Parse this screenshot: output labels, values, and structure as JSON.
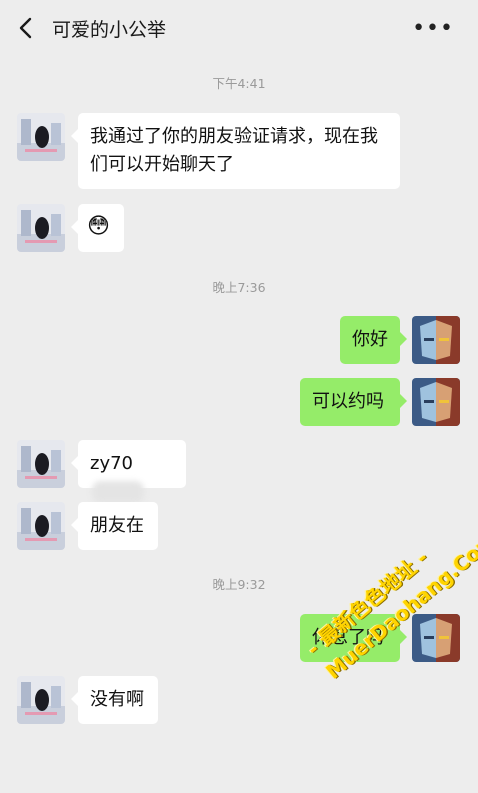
{
  "header": {
    "title": "可爱的小公举",
    "back_icon": "chevron-left-icon",
    "more_icon": "more-dots-icon"
  },
  "timestamps": [
    "下午4:41",
    "晚上7:36",
    "晚上9:32"
  ],
  "messages": [
    {
      "side": "left",
      "text": "我通过了你的朋友验证请求，现在我们可以开始聊天了"
    },
    {
      "side": "left",
      "text": "😳",
      "type": "emoji"
    },
    {
      "side": "right",
      "text": "你好"
    },
    {
      "side": "right",
      "text": "可以约吗"
    },
    {
      "side": "left",
      "text": "zy70",
      "note_blurred": true
    },
    {
      "side": "left",
      "text": "朋友在"
    },
    {
      "side": "right",
      "text": "休息了吗"
    },
    {
      "side": "left",
      "text": "没有啊"
    }
  ],
  "watermark": {
    "line1": "- 最新色色地址 -",
    "line2": "MuerDaohang.Com"
  },
  "colors": {
    "background": "#ededed",
    "bubble_self": "#95ec69",
    "bubble_other": "#ffffff",
    "watermark": "#ffd400"
  }
}
